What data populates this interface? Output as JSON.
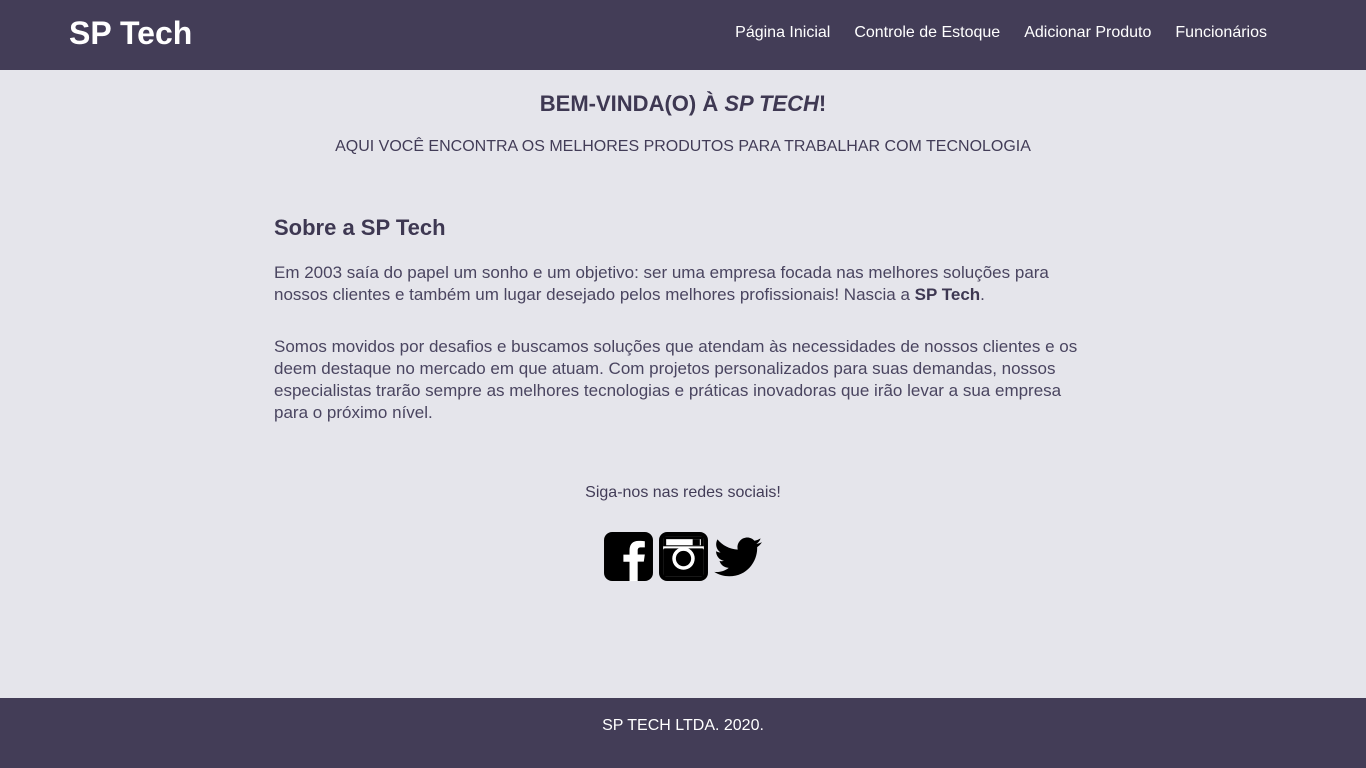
{
  "header": {
    "brand": "SP Tech",
    "nav": [
      "Página Inicial",
      "Controle de Estoque",
      "Adicionar Produto",
      "Funcionários"
    ]
  },
  "hero": {
    "title_prefix": "BEM-VINDA(O) À ",
    "title_brand": "SP TECH",
    "title_suffix": "!",
    "subtitle": "AQUI VOCÊ ENCONTRA OS MELHORES PRODUTOS PARA TRABALHAR COM TECNOLOGIA"
  },
  "about": {
    "heading": "Sobre a SP Tech",
    "p1_text": "Em 2003 saía do papel um sonho e um objetivo: ser uma empresa focada nas melhores soluções para nossos clientes e também um lugar desejado pelos melhores profissionais! Nascia a ",
    "p1_brand": "SP Tech",
    "p1_end": ".",
    "p2": "Somos movidos por desafios e buscamos soluções que atendam às necessidades de nossos clientes e os deem destaque no mercado em que atuam. Com projetos personalizados para suas demandas, nossos especialistas trarão sempre as melhores tecnologias e práticas inovadoras que irão levar a sua empresa para o próximo nível."
  },
  "social": {
    "label": "Siga-nos nas redes sociais!",
    "icons": [
      "facebook-icon",
      "instagram-icon",
      "twitter-icon"
    ]
  },
  "footer": {
    "text": "SP TECH LTDA. 2020."
  },
  "colors": {
    "bar": "#433d57",
    "background": "#e5e5eb",
    "text": "#423c57"
  }
}
